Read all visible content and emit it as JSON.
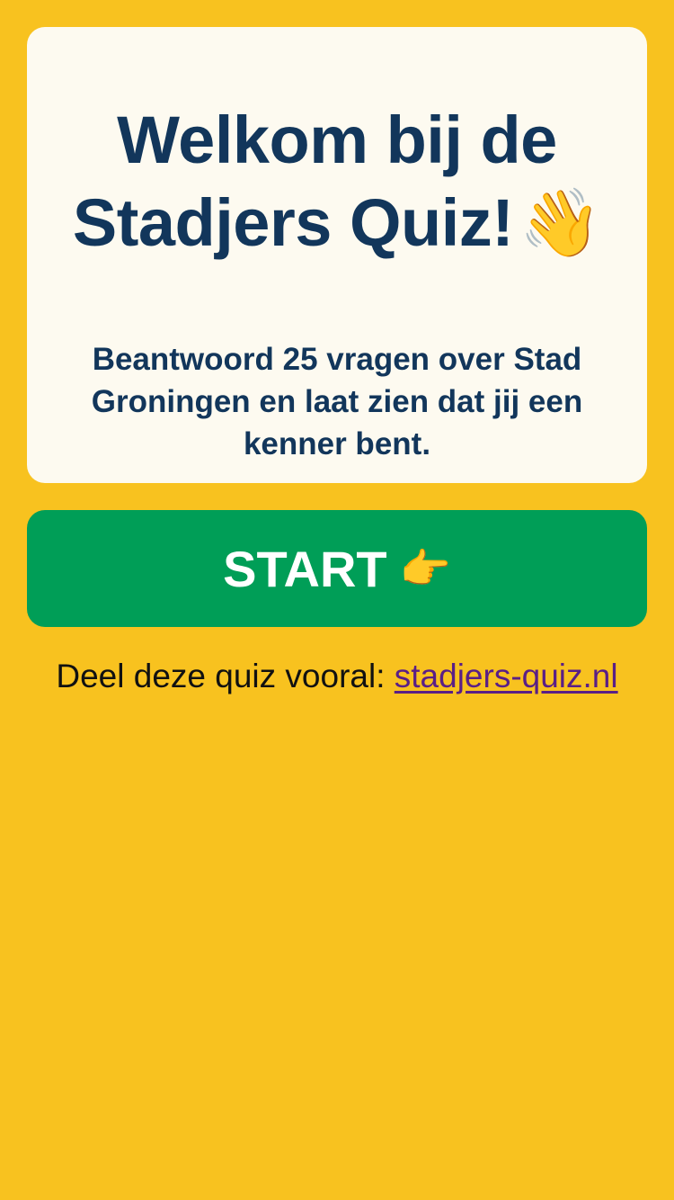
{
  "colors": {
    "background": "#f8c21f",
    "card": "#fdfaf0",
    "heading": "#12365b",
    "start_button": "#009e57",
    "link": "#5a1f86"
  },
  "welcome": {
    "title": "Welkom bij de Stadjers Quiz!",
    "title_emoji": "👋",
    "title_emoji_name": "waving-hand-icon",
    "subtitle": "Beantwoord 25 vragen over Stad Groningen en laat zien dat jij een kenner bent."
  },
  "start_button": {
    "label": "START",
    "emoji": "👉",
    "emoji_name": "pointing-right-icon"
  },
  "share": {
    "text": "Deel deze quiz vooral: ",
    "link_text": "stadjers-quiz.nl"
  }
}
